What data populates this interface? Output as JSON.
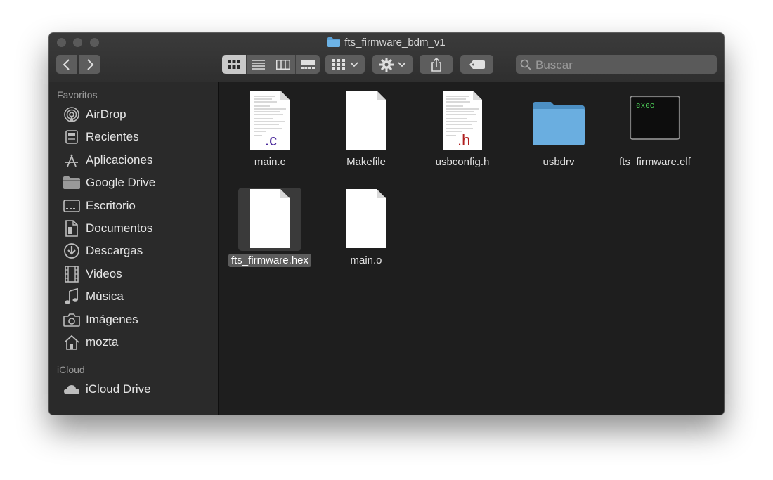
{
  "window": {
    "title": "fts_firmware_bdm_v1"
  },
  "toolbar": {
    "search_placeholder": "Buscar",
    "view_modes": [
      "icon-view",
      "list-view",
      "column-view",
      "gallery-view"
    ],
    "active_view": "icon-view"
  },
  "sidebar": {
    "favorites_header": "Favoritos",
    "favorites": [
      {
        "label": "AirDrop",
        "icon": "airdrop-icon"
      },
      {
        "label": "Recientes",
        "icon": "recents-icon"
      },
      {
        "label": "Aplicaciones",
        "icon": "applications-icon"
      },
      {
        "label": "Google Drive",
        "icon": "folder-icon"
      },
      {
        "label": "Escritorio",
        "icon": "desktop-icon"
      },
      {
        "label": "Documentos",
        "icon": "documents-icon"
      },
      {
        "label": "Descargas",
        "icon": "downloads-icon"
      },
      {
        "label": "Videos",
        "icon": "film-icon"
      },
      {
        "label": "Música",
        "icon": "music-note-icon"
      },
      {
        "label": "Imágenes",
        "icon": "camera-icon"
      },
      {
        "label": "mozta",
        "icon": "home-icon"
      }
    ],
    "icloud_header": "iCloud",
    "icloud": [
      {
        "label": "iCloud Drive",
        "icon": "cloud-icon"
      }
    ]
  },
  "files": [
    {
      "name": "main.c",
      "type": "c-source",
      "badge": ".c",
      "badge_color": "#4b2a9c"
    },
    {
      "name": "Makefile",
      "type": "blank-document"
    },
    {
      "name": "usbconfig.h",
      "type": "c-header",
      "badge": ".h",
      "badge_color": "#b01f1f"
    },
    {
      "name": "usbdrv",
      "type": "folder"
    },
    {
      "name": "fts_firmware.elf",
      "type": "executable",
      "badge": "exec",
      "badge_color": "#4fd25a"
    },
    {
      "name": "fts_firmware.hex",
      "type": "blank-document",
      "selected": true
    },
    {
      "name": "main.o",
      "type": "blank-document"
    }
  ],
  "colors": {
    "window_bg": "#1e1e1e",
    "sidebar_bg": "#2a2a2a",
    "folder_blue": "#5a9fd4",
    "selection": "#5c5c5c"
  }
}
